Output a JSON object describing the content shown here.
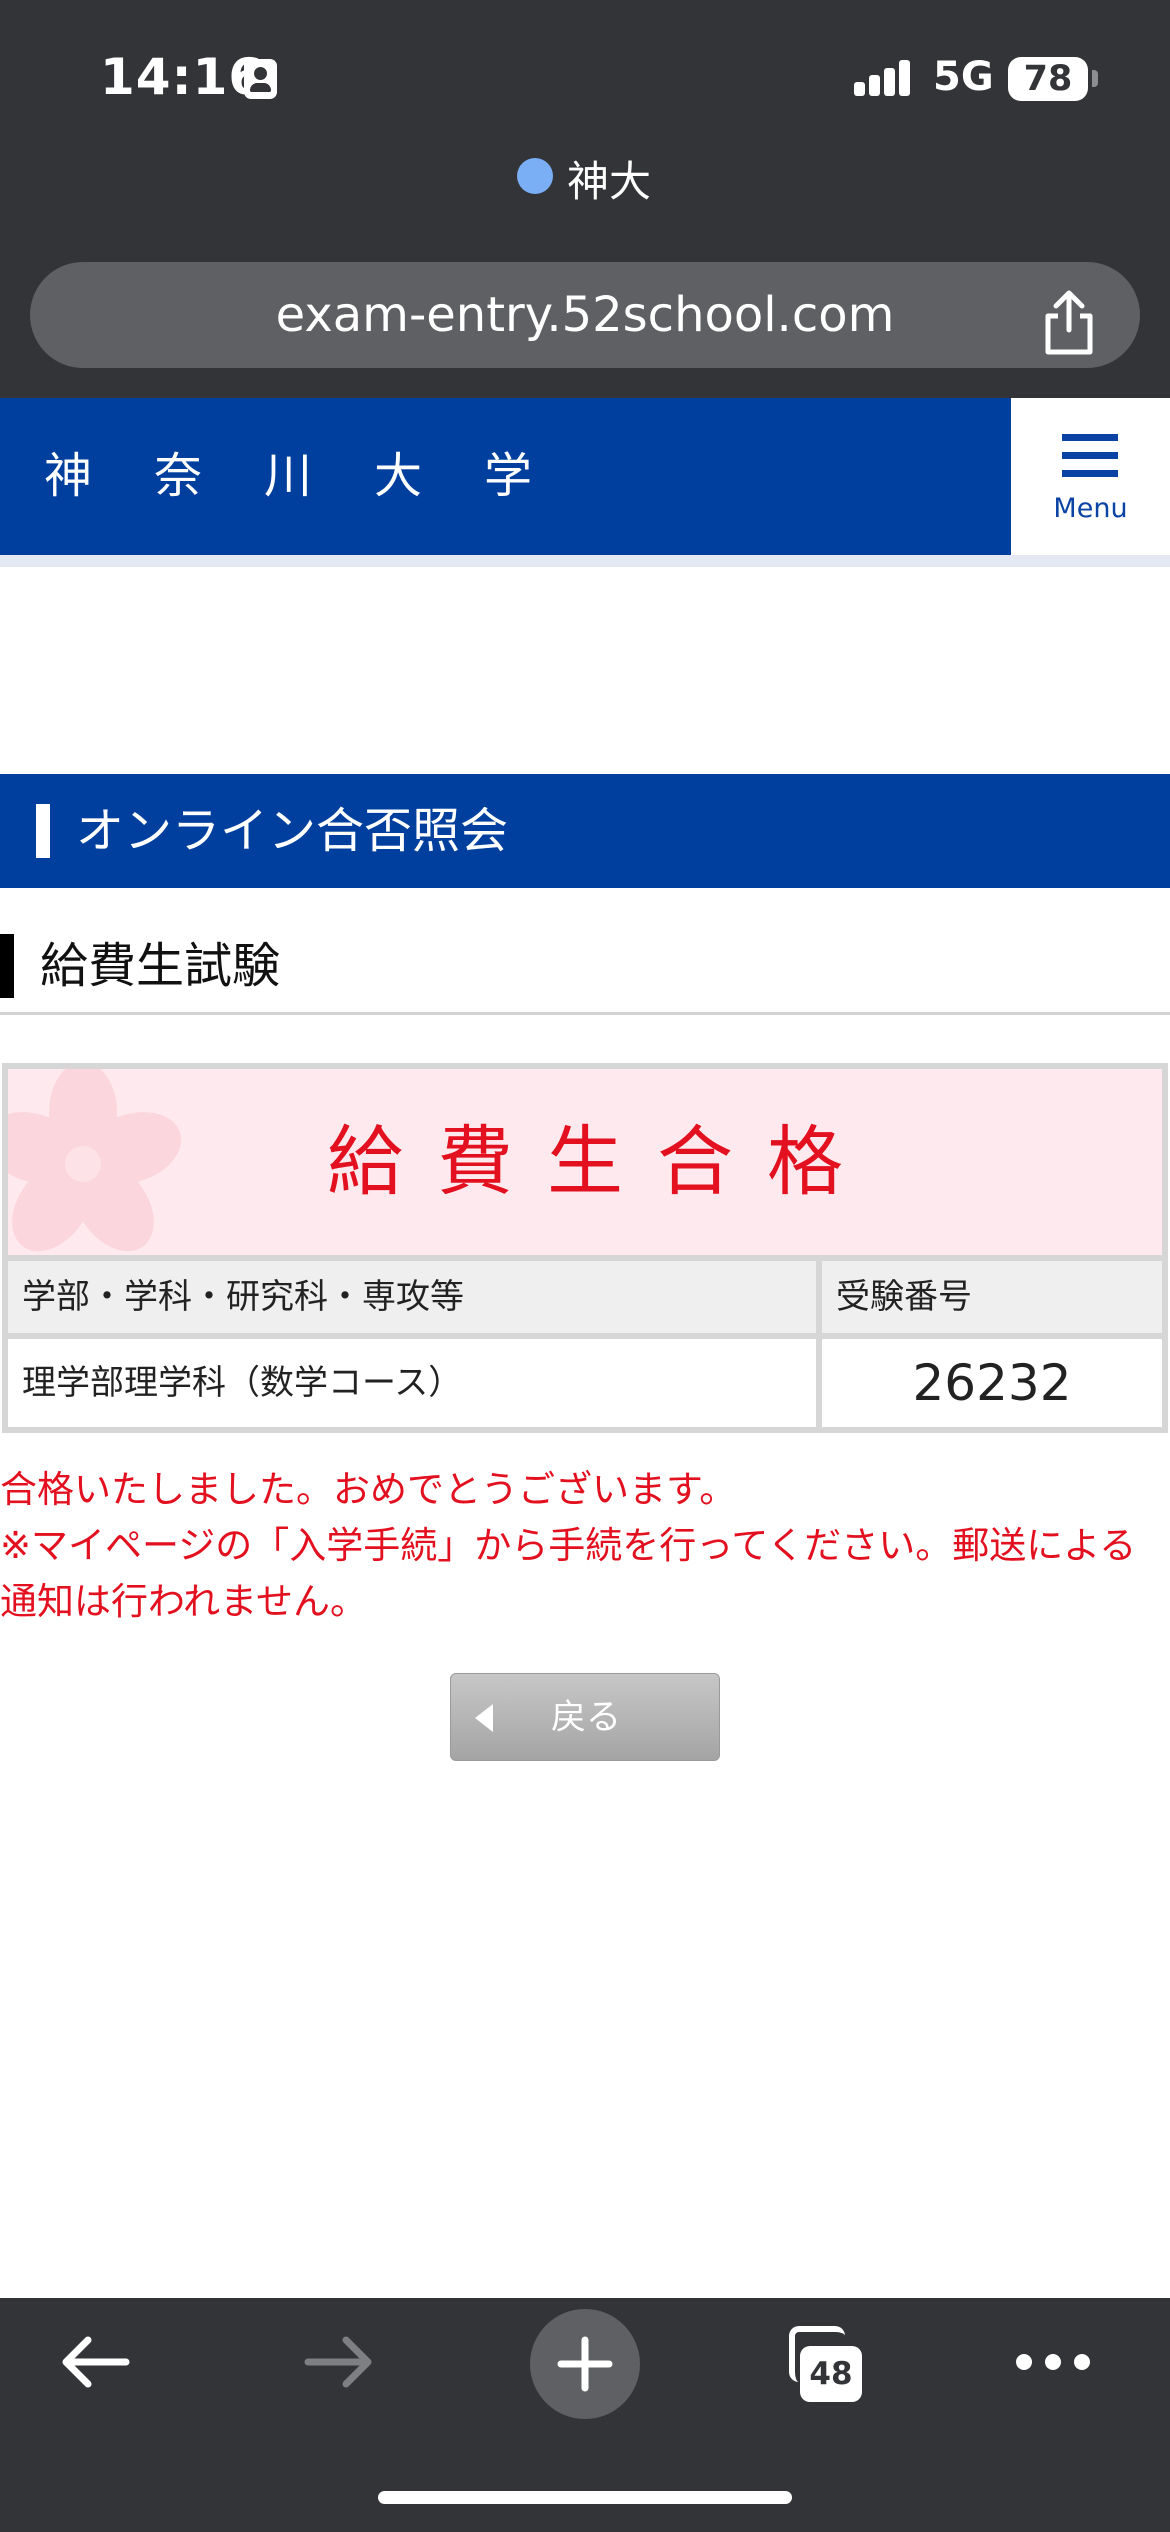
{
  "status_bar": {
    "time": "14:16",
    "network": "5G",
    "battery": "78"
  },
  "browser": {
    "site_name": "神大",
    "url": "exam-entry.52school.com",
    "tabs_count": "48"
  },
  "header": {
    "logo": "神奈川大学",
    "menu_label": "Menu"
  },
  "section": {
    "title": "オンライン合否照会",
    "subtitle": "給費生試験"
  },
  "result": {
    "title": "給費生合格",
    "col_dept": "学部・学科・研究科・専攻等",
    "col_number": "受験番号",
    "dept": "理学部理学科（数学コース）",
    "number": "26232"
  },
  "message": {
    "line1": "合格いたしました。おめでとうございます。",
    "line2": "※マイページの「入学手続」から手続を行ってください。郵送による通知は行われません。"
  },
  "back_button": {
    "label": "戻る"
  },
  "colors": {
    "brand_blue": "#003f9d",
    "pass_red": "#e3101f",
    "banner_pink": "#feeaee"
  }
}
